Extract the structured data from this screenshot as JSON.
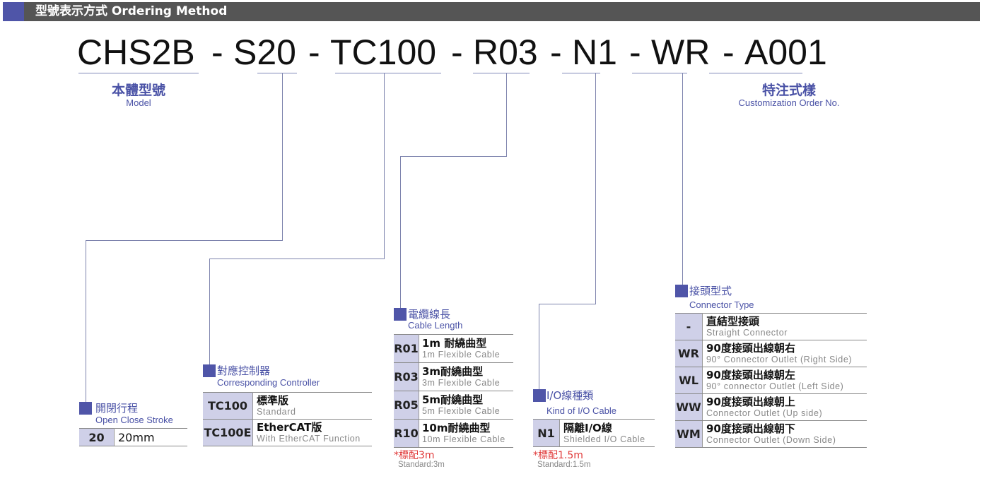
{
  "header": {
    "title": "型號表示方式 Ordering Method"
  },
  "model_code": {
    "segments": [
      "CHS2B",
      "S20",
      "TC100",
      "R03",
      "N1",
      "WR",
      "A001"
    ],
    "separator": "-"
  },
  "model_label": {
    "zh": "本體型號",
    "en": "Model"
  },
  "custom_label": {
    "zh": "特注式樣",
    "en": "Customization Order No."
  },
  "colors": {
    "accent": "#4f55a8",
    "header_bg": "#555555",
    "code_cell_bg": "#cfd0e8",
    "note_red": "#e03a3a"
  },
  "groups": {
    "stroke": {
      "title_zh": "開閉行程",
      "title_en": "Open Close Stroke",
      "rows": [
        {
          "code": "20",
          "zh": "20mm",
          "en": ""
        }
      ]
    },
    "controller": {
      "title_zh": "對應控制器",
      "title_en": "Corresponding Controller",
      "rows": [
        {
          "code": "TC100",
          "zh": "標準版",
          "en": "Standard"
        },
        {
          "code": "TC100E",
          "zh": "EtherCAT版",
          "en": "With EtherCAT Function"
        }
      ]
    },
    "cable": {
      "title_zh": "電纜線長",
      "title_en": "Cable Length",
      "rows": [
        {
          "code": "R01",
          "zh": "1m 耐繞曲型",
          "en": "1m Flexible Cable"
        },
        {
          "code": "R03",
          "zh": "3m耐繞曲型",
          "en": "3m Flexible Cable"
        },
        {
          "code": "R05",
          "zh": "5m耐繞曲型",
          "en": "5m Flexible Cable"
        },
        {
          "code": "R10",
          "zh": "10m耐繞曲型",
          "en": "10m Flexible Cable"
        }
      ],
      "note_zh": "*標配3m",
      "note_en": "Standard:3m"
    },
    "io": {
      "title_zh": "I/O線種類",
      "title_en": "Kind of I/O Cable",
      "rows": [
        {
          "code": "N1",
          "zh": "隔離I/O線",
          "en": "Shielded I/O Cable"
        }
      ],
      "note_zh": "*標配1.5m",
      "note_en": "Standard:1.5m"
    },
    "connector": {
      "title_zh": "接頭型式",
      "title_en": "Connector Type",
      "rows": [
        {
          "code": "-",
          "zh": "直結型接頭",
          "en": "Straight Connector"
        },
        {
          "code": "WR",
          "zh": "90度接頭出線朝右",
          "en": "90° Connector Outlet (Right Side)"
        },
        {
          "code": "WL",
          "zh": "90度接頭出線朝左",
          "en": "90° connector Outlet (Left Side)"
        },
        {
          "code": "WW",
          "zh": "90度接頭出線朝上",
          "en": "Connector Outlet (Up side)"
        },
        {
          "code": "WM",
          "zh": "90度接頭出線朝下",
          "en": "Connector Outlet (Down Side)"
        }
      ]
    }
  }
}
